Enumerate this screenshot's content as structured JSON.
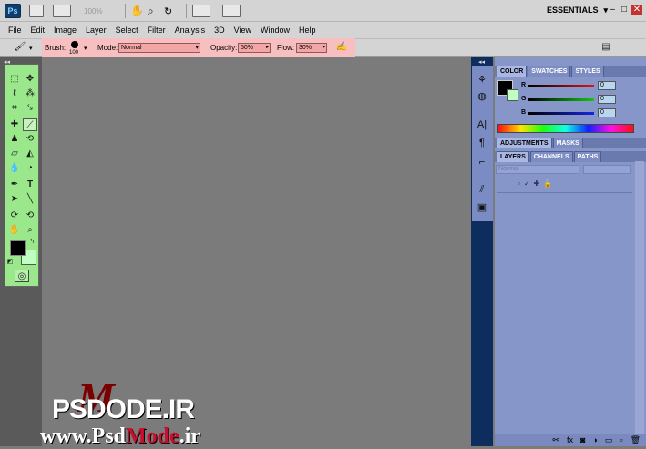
{
  "app": {
    "logo": "Ps",
    "workspace": "ESSENTIALS",
    "zoom": "100%"
  },
  "menu": [
    "File",
    "Edit",
    "Image",
    "Layer",
    "Select",
    "Filter",
    "Analysis",
    "3D",
    "View",
    "Window",
    "Help"
  ],
  "options": {
    "brush_label": "Brush:",
    "brush_size": "100",
    "mode_label": "Mode:",
    "mode_value": "Normal",
    "opacity_label": "Opacity:",
    "opacity_value": "50%",
    "flow_label": "Flow:",
    "flow_value": "30%"
  },
  "color_panel": {
    "tabs": [
      "COLOR",
      "SWATCHES",
      "STYLES"
    ],
    "channels": [
      {
        "label": "R",
        "value": "0",
        "color": "#d41818"
      },
      {
        "label": "G",
        "value": "0",
        "color": "#18a818"
      },
      {
        "label": "B",
        "value": "0",
        "color": "#1830d4"
      }
    ]
  },
  "adjust_panel": {
    "tabs": [
      "ADJUSTMENTS",
      "MASKS"
    ]
  },
  "layers_panel": {
    "tabs": [
      "LAYERS",
      "CHANNELS",
      "PATHS"
    ],
    "blend_mode": "Normal"
  },
  "colors": {
    "menu_highlight": "#f1f263",
    "options_highlight": "#f7bfbf",
    "toolbox_highlight": "#9ae88b",
    "dock_bg": "#0c2d5e",
    "panel_bg": "#8796c8"
  },
  "watermark": {
    "line1": "PSDODE.IR",
    "line2_part1": "www.Psd",
    "line2_part2": "Mode",
    "line2_part3": ".ir",
    "overlay_letter": "M"
  }
}
